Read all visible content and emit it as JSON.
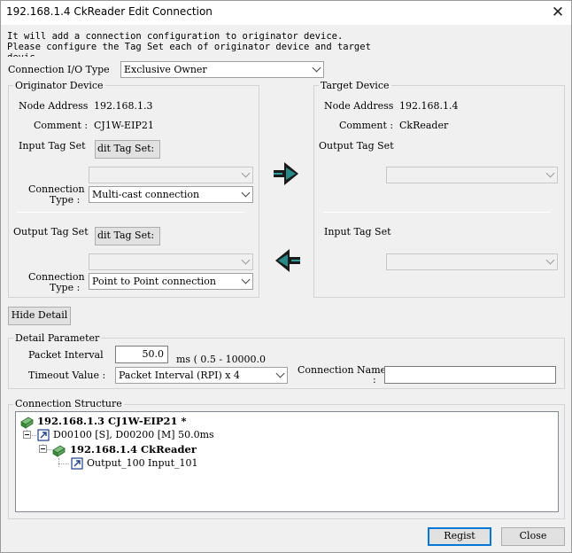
{
  "window": {
    "title": "192.168.1.4 CkReader Edit Connection",
    "close_glyph": "✕"
  },
  "description": {
    "line1": "It will add a connection configuration to originator device.",
    "line2": "Please configure the Tag Set each of originator device and target",
    "line3": "devic..."
  },
  "connection_io": {
    "label": "Connection I/O Type",
    "value": "Exclusive Owner"
  },
  "originator": {
    "group_title": "Originator Device",
    "node_address_label": "Node Address",
    "node_address": "192.168.1.3",
    "comment_label": "Comment :",
    "comment": "CJ1W-EIP21",
    "input_tag_set_label": "Input Tag Set",
    "input_edit_button": "dit Tag Set:",
    "input_tag_value": "",
    "input_conn_type_label_1": "Connection",
    "input_conn_type_label_2": "Type :",
    "input_conn_type": "Multi-cast connection",
    "output_tag_set_label": "Output Tag Set",
    "output_edit_button": "dit Tag Set:",
    "output_tag_value": "",
    "output_conn_type_label_1": "Connection",
    "output_conn_type_label_2": "Type :",
    "output_conn_type": "Point to Point connection"
  },
  "target": {
    "group_title": "Target Device",
    "node_address_label": "Node Address",
    "node_address": "192.168.1.4",
    "comment_label": "Comment :",
    "comment": "CkReader",
    "output_tag_set_label": "Output Tag Set",
    "output_tag_value": "",
    "input_tag_set_label": "Input Tag Set",
    "input_tag_value": ""
  },
  "hide_detail_button": "Hide Detail",
  "detail": {
    "group_title": "Detail Parameter",
    "packet_interval_label": "Packet Interval",
    "packet_interval_value": "50.0",
    "packet_interval_range": "ms ( 0.5 - 10000.0",
    "timeout_label": "Timeout Value :",
    "timeout_value": "Packet Interval (RPI) x 4",
    "connection_name_label_1": "Connection Name",
    "connection_name_label_2": ":",
    "connection_name_value": ""
  },
  "structure": {
    "group_title": "Connection Structure",
    "root": "192.168.1.3 CJ1W-EIP21 *",
    "connection": "D00100 [S], D00200 [M] 50.0ms",
    "target": "192.168.1.4 CkReader",
    "tags": "Output_100 Input_101"
  },
  "buttons": {
    "regist": "Regist",
    "close": "Close"
  },
  "colors": {
    "arrow_dark": "#1a1a1a",
    "arrow_accent": "#2a9d9d",
    "default_button_border": "#0078d7",
    "device_icon_green": "#3a8a3a"
  }
}
